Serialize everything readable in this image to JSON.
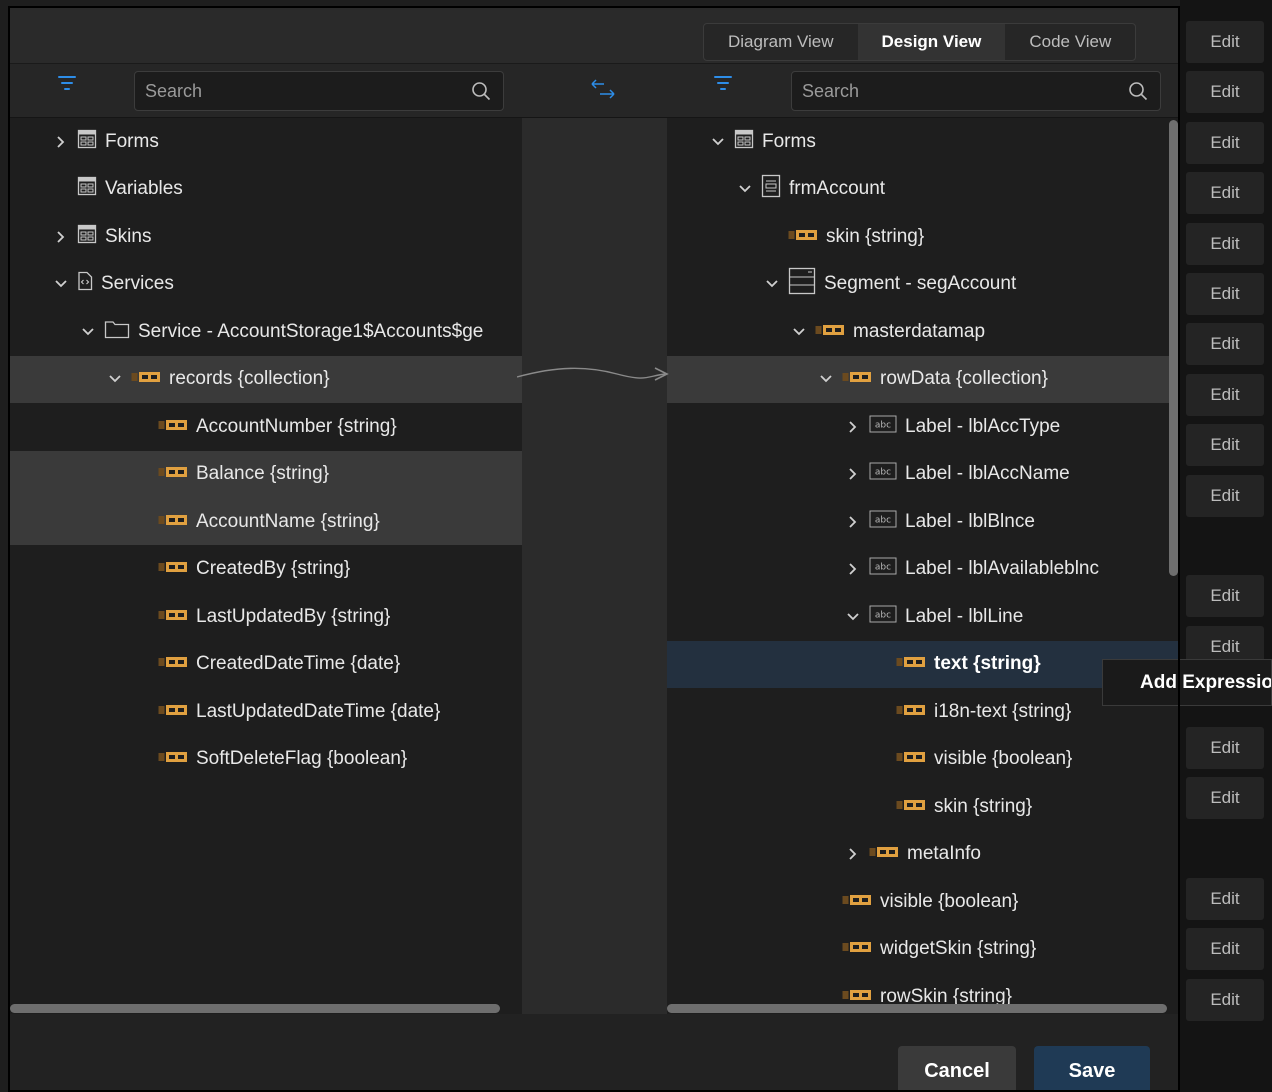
{
  "view_tabs": [
    {
      "label": "Diagram View",
      "active": false
    },
    {
      "label": "Design View",
      "active": true
    },
    {
      "label": "Code View",
      "active": false
    }
  ],
  "left_search": {
    "placeholder": "Search"
  },
  "right_search": {
    "placeholder": "Search"
  },
  "left_tree": [
    {
      "label": "Forms",
      "chevron": "right",
      "icon": "form",
      "depth": 0
    },
    {
      "label": "Variables",
      "chevron": "none",
      "icon": "form",
      "depth": 0
    },
    {
      "label": "Skins",
      "chevron": "right",
      "icon": "form",
      "depth": 0
    },
    {
      "label": "Services",
      "chevron": "down",
      "icon": "service",
      "depth": 0
    },
    {
      "label": "Service - AccountStorage1$Accounts$ge",
      "chevron": "down",
      "icon": "folder",
      "depth": 1
    },
    {
      "label": "records {collection}",
      "chevron": "down",
      "icon": "field",
      "depth": 2,
      "state": "hl"
    },
    {
      "label": "AccountNumber {string}",
      "chevron": "none",
      "icon": "field",
      "depth": 3
    },
    {
      "label": "Balance {string}",
      "chevron": "none",
      "icon": "field",
      "depth": 3,
      "state": "hl"
    },
    {
      "label": "AccountName {string}",
      "chevron": "none",
      "icon": "field",
      "depth": 3,
      "state": "hl"
    },
    {
      "label": "CreatedBy {string}",
      "chevron": "none",
      "icon": "field",
      "depth": 3
    },
    {
      "label": "LastUpdatedBy {string}",
      "chevron": "none",
      "icon": "field",
      "depth": 3
    },
    {
      "label": "CreatedDateTime {date}",
      "chevron": "none",
      "icon": "field",
      "depth": 3
    },
    {
      "label": "LastUpdatedDateTime {date}",
      "chevron": "none",
      "icon": "field",
      "depth": 3
    },
    {
      "label": "SoftDeleteFlag {boolean}",
      "chevron": "none",
      "icon": "field",
      "depth": 3
    }
  ],
  "right_tree": [
    {
      "label": "Forms",
      "chevron": "down",
      "icon": "form",
      "depth": 0
    },
    {
      "label": "frmAccount",
      "chevron": "down",
      "icon": "frm",
      "depth": 1
    },
    {
      "label": "skin {string}",
      "chevron": "none",
      "icon": "field",
      "depth": 2
    },
    {
      "label": "Segment - segAccount",
      "chevron": "down",
      "icon": "segment",
      "depth": 2
    },
    {
      "label": "masterdatamap",
      "chevron": "down",
      "icon": "field",
      "depth": 3
    },
    {
      "label": "rowData {collection}",
      "chevron": "down",
      "icon": "field",
      "depth": 4,
      "state": "hl"
    },
    {
      "label": "Label - lblAccType",
      "chevron": "right",
      "icon": "abc",
      "depth": 5
    },
    {
      "label": "Label - lblAccName",
      "chevron": "right",
      "icon": "abc",
      "depth": 5
    },
    {
      "label": "Label - lblBlnce",
      "chevron": "right",
      "icon": "abc",
      "depth": 5
    },
    {
      "label": "Label - lblAvailableblnc",
      "chevron": "right",
      "icon": "abc",
      "depth": 5
    },
    {
      "label": "Label - lblLine",
      "chevron": "down",
      "icon": "abc",
      "depth": 5
    },
    {
      "label": "text {string}",
      "chevron": "none",
      "icon": "field",
      "depth": 6,
      "state": "sel"
    },
    {
      "label": "i18n-text {string}",
      "chevron": "none",
      "icon": "field",
      "depth": 6
    },
    {
      "label": "visible {boolean}",
      "chevron": "none",
      "icon": "field",
      "depth": 6
    },
    {
      "label": "skin {string}",
      "chevron": "none",
      "icon": "field",
      "depth": 6
    },
    {
      "label": "metaInfo",
      "chevron": "right",
      "icon": "field",
      "depth": 5
    },
    {
      "label": "visible {boolean}",
      "chevron": "none",
      "icon": "field",
      "depth": 4
    },
    {
      "label": "widgetSkin {string}",
      "chevron": "none",
      "icon": "field",
      "depth": 4
    },
    {
      "label": "rowSkin {string}",
      "chevron": "none",
      "icon": "field",
      "depth": 4
    }
  ],
  "edit_label": "Edit",
  "edit_slots": [
    0,
    1,
    2,
    3,
    4,
    5,
    6,
    7,
    8,
    9,
    11,
    12,
    14,
    15,
    17,
    18,
    19
  ],
  "tooltip": "Add Expressio",
  "footer": {
    "cancel_label": "Cancel",
    "save_label": "Save"
  },
  "colors": {
    "accent": "#2d8de8",
    "field_icon": "#e0a040",
    "save_bg": "#1f3a55"
  }
}
